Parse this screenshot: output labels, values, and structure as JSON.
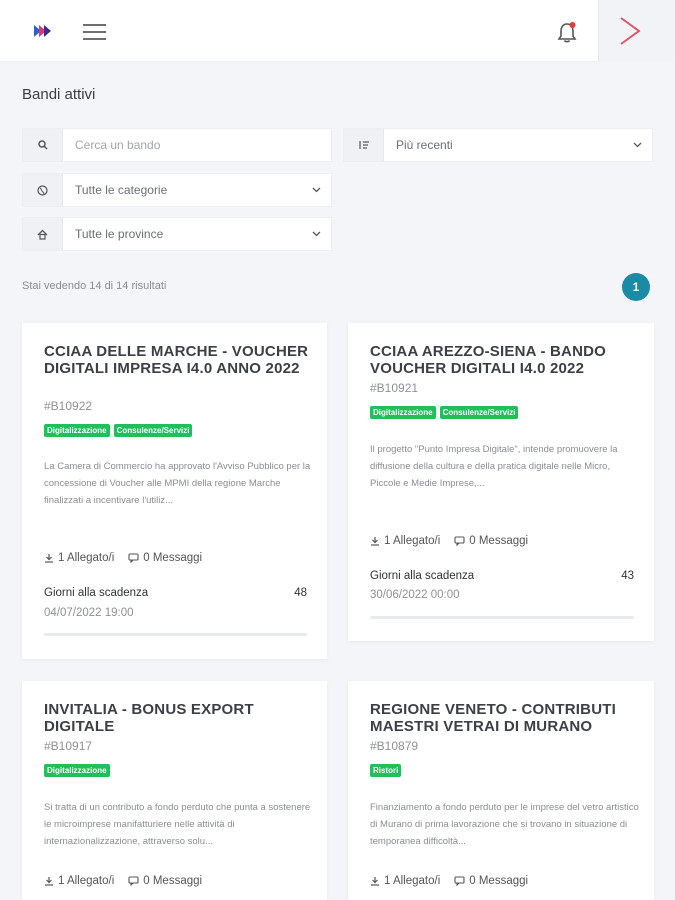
{
  "header": {
    "logo_alt": "logo-icon",
    "menu_icon": "hamburger-icon",
    "notification_icon": "bell-icon",
    "collapse_icon": "chevron-right-icon"
  },
  "page": {
    "title": "Bandi attivi"
  },
  "filters": {
    "search_placeholder": "Cerca un bando",
    "sort_value": "Più recenti",
    "category_value": "Tutte le categorie",
    "province_value": "Tutte le province"
  },
  "results": {
    "text": "Stai vedendo 14 di 14 risultati",
    "page": "1"
  },
  "colors": {
    "accent": "#1a8aa6",
    "tag": "#1fbf5a",
    "notification_dot": "#e53935",
    "collapse_chevron": "#e0566a"
  },
  "cards": [
    {
      "title": "CCIAA DELLE MARCHE - VOUCHER DIGITALI IMPRESA I4.0 ANNO 2022",
      "code": "#B10922",
      "tags": [
        "Digitalizzazione",
        "Consulenze/Servizi"
      ],
      "description": "La Camera di Commercio ha approvato l'Avviso Pubblico per la concessione di Voucher alle MPMI della regione Marche finalizzati a incentivare l'utiliz...",
      "attachments": "1 Allegato/i",
      "messages": "0 Messaggi",
      "deadline_label": "Giorni alla scadenza",
      "days": "48",
      "date": "04/07/2022 19:00"
    },
    {
      "title": "CCIAA AREZZO-SIENA - BANDO VOUCHER DIGITALI I4.0 2022",
      "code": "#B10921",
      "tags": [
        "Digitalizzazione",
        "Consulenze/Servizi"
      ],
      "description": "Il progetto \"Punto Impresa Digitale\", intende promuovere la diffusione della cultura e della pratica digitale nelle Micro, Piccole e Medie Imprese,...",
      "attachments": "1 Allegato/i",
      "messages": "0 Messaggi",
      "deadline_label": "Giorni alla scadenza",
      "days": "43",
      "date": "30/06/2022 00:00"
    },
    {
      "title": "INVITALIA - BONUS EXPORT DIGITALE",
      "code": "#B10917",
      "tags": [
        "Digitalizzazione"
      ],
      "description": "Si tratta di un contributo a fondo perduto che punta a sostenere le microimprese manifatturiere nelle attività di internazionalizzazione, attraverso solu...",
      "attachments": "1 Allegato/i",
      "messages": "0 Messaggi"
    },
    {
      "title": "REGIONE VENETO - CONTRIBUTI MAESTRI VETRAI DI MURANO",
      "code": "#B10879",
      "tags": [
        "Ristori"
      ],
      "description": "Finanziamento a fondo perduto per le imprese del vetro artistico di Murano di prima lavorazione che si trovano in situazione di temporanea difficoltà...",
      "attachments": "1 Allegato/i",
      "messages": "0 Messaggi"
    }
  ]
}
